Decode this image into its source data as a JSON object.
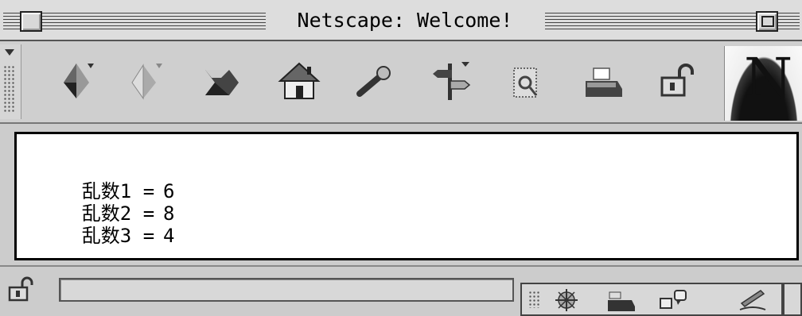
{
  "window": {
    "title": "Netscape: Welcome!"
  },
  "toolbar": {
    "buttons": [
      {
        "name": "back-icon"
      },
      {
        "name": "forward-icon"
      },
      {
        "name": "reload-icon"
      },
      {
        "name": "home-icon"
      },
      {
        "name": "search-icon"
      },
      {
        "name": "guide-icon"
      },
      {
        "name": "images-icon"
      },
      {
        "name": "print-icon"
      },
      {
        "name": "security-icon"
      }
    ],
    "logo": "N"
  },
  "content": {
    "lines": [
      {
        "label": "乱数1 =",
        "value": "6"
      },
      {
        "label": "乱数2 =",
        "value": "8"
      },
      {
        "label": "乱数3 =",
        "value": "4"
      }
    ]
  },
  "status": {
    "text": "",
    "components": [
      "navigator-icon",
      "mail-icon",
      "discussions-icon",
      "composer-icon"
    ]
  }
}
